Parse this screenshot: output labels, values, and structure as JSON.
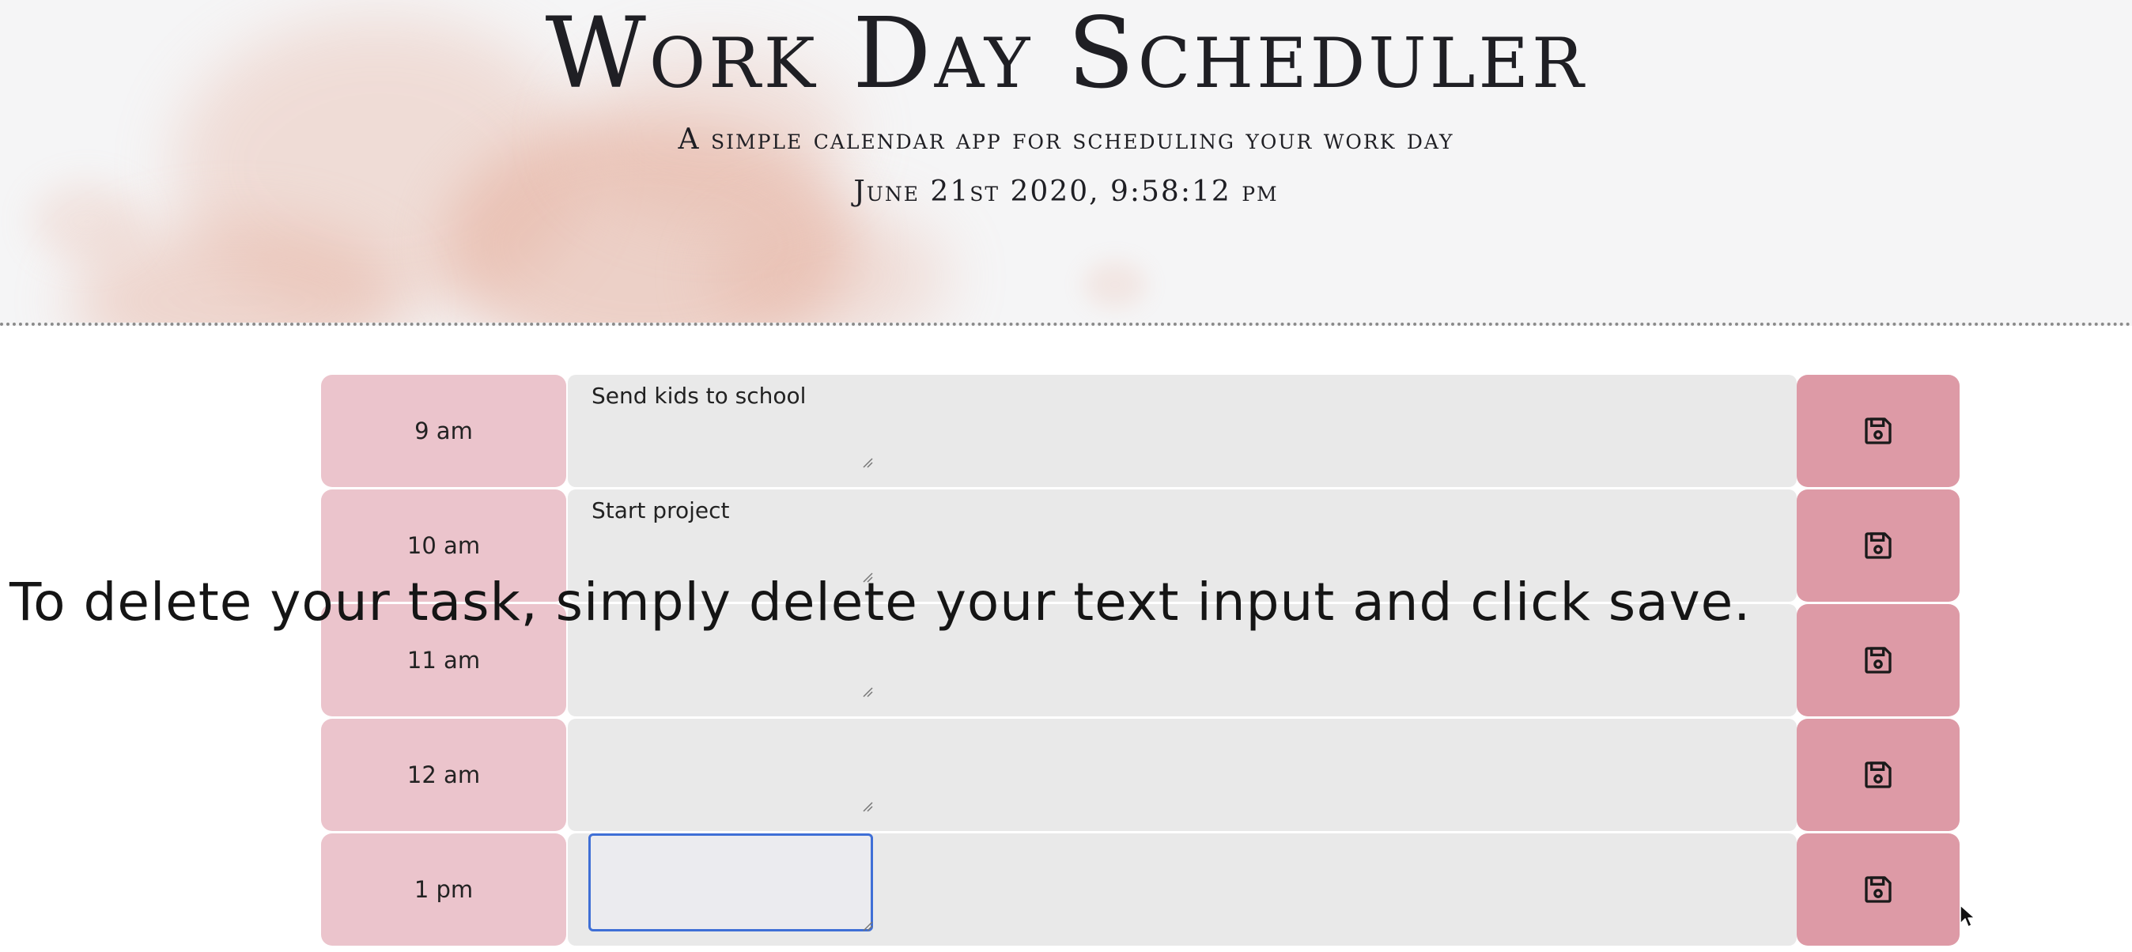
{
  "header": {
    "title": "Work Day Scheduler",
    "subtitle": "A simple calendar app for scheduling your work day",
    "datetime": "June 21st 2020, 9:58:12 pm"
  },
  "time_blocks": [
    {
      "hour": "9 am",
      "task": "Send kids to school"
    },
    {
      "hour": "10 am",
      "task": "Start project"
    },
    {
      "hour": "11 am",
      "task": ""
    },
    {
      "hour": "12 am",
      "task": ""
    },
    {
      "hour": "1 pm",
      "task": ""
    }
  ],
  "overlay": {
    "text": "To delete your task, simply delete your text input and click save."
  },
  "icons": {
    "save": "floppy-disk-icon",
    "cursor": "mouse-pointer-icon"
  },
  "colors": {
    "hour_bg": "#ebc4cc",
    "save_bg": "#dd9aa6",
    "textarea_bg": "#e9e9e9",
    "focus": "#3f6fd6"
  }
}
